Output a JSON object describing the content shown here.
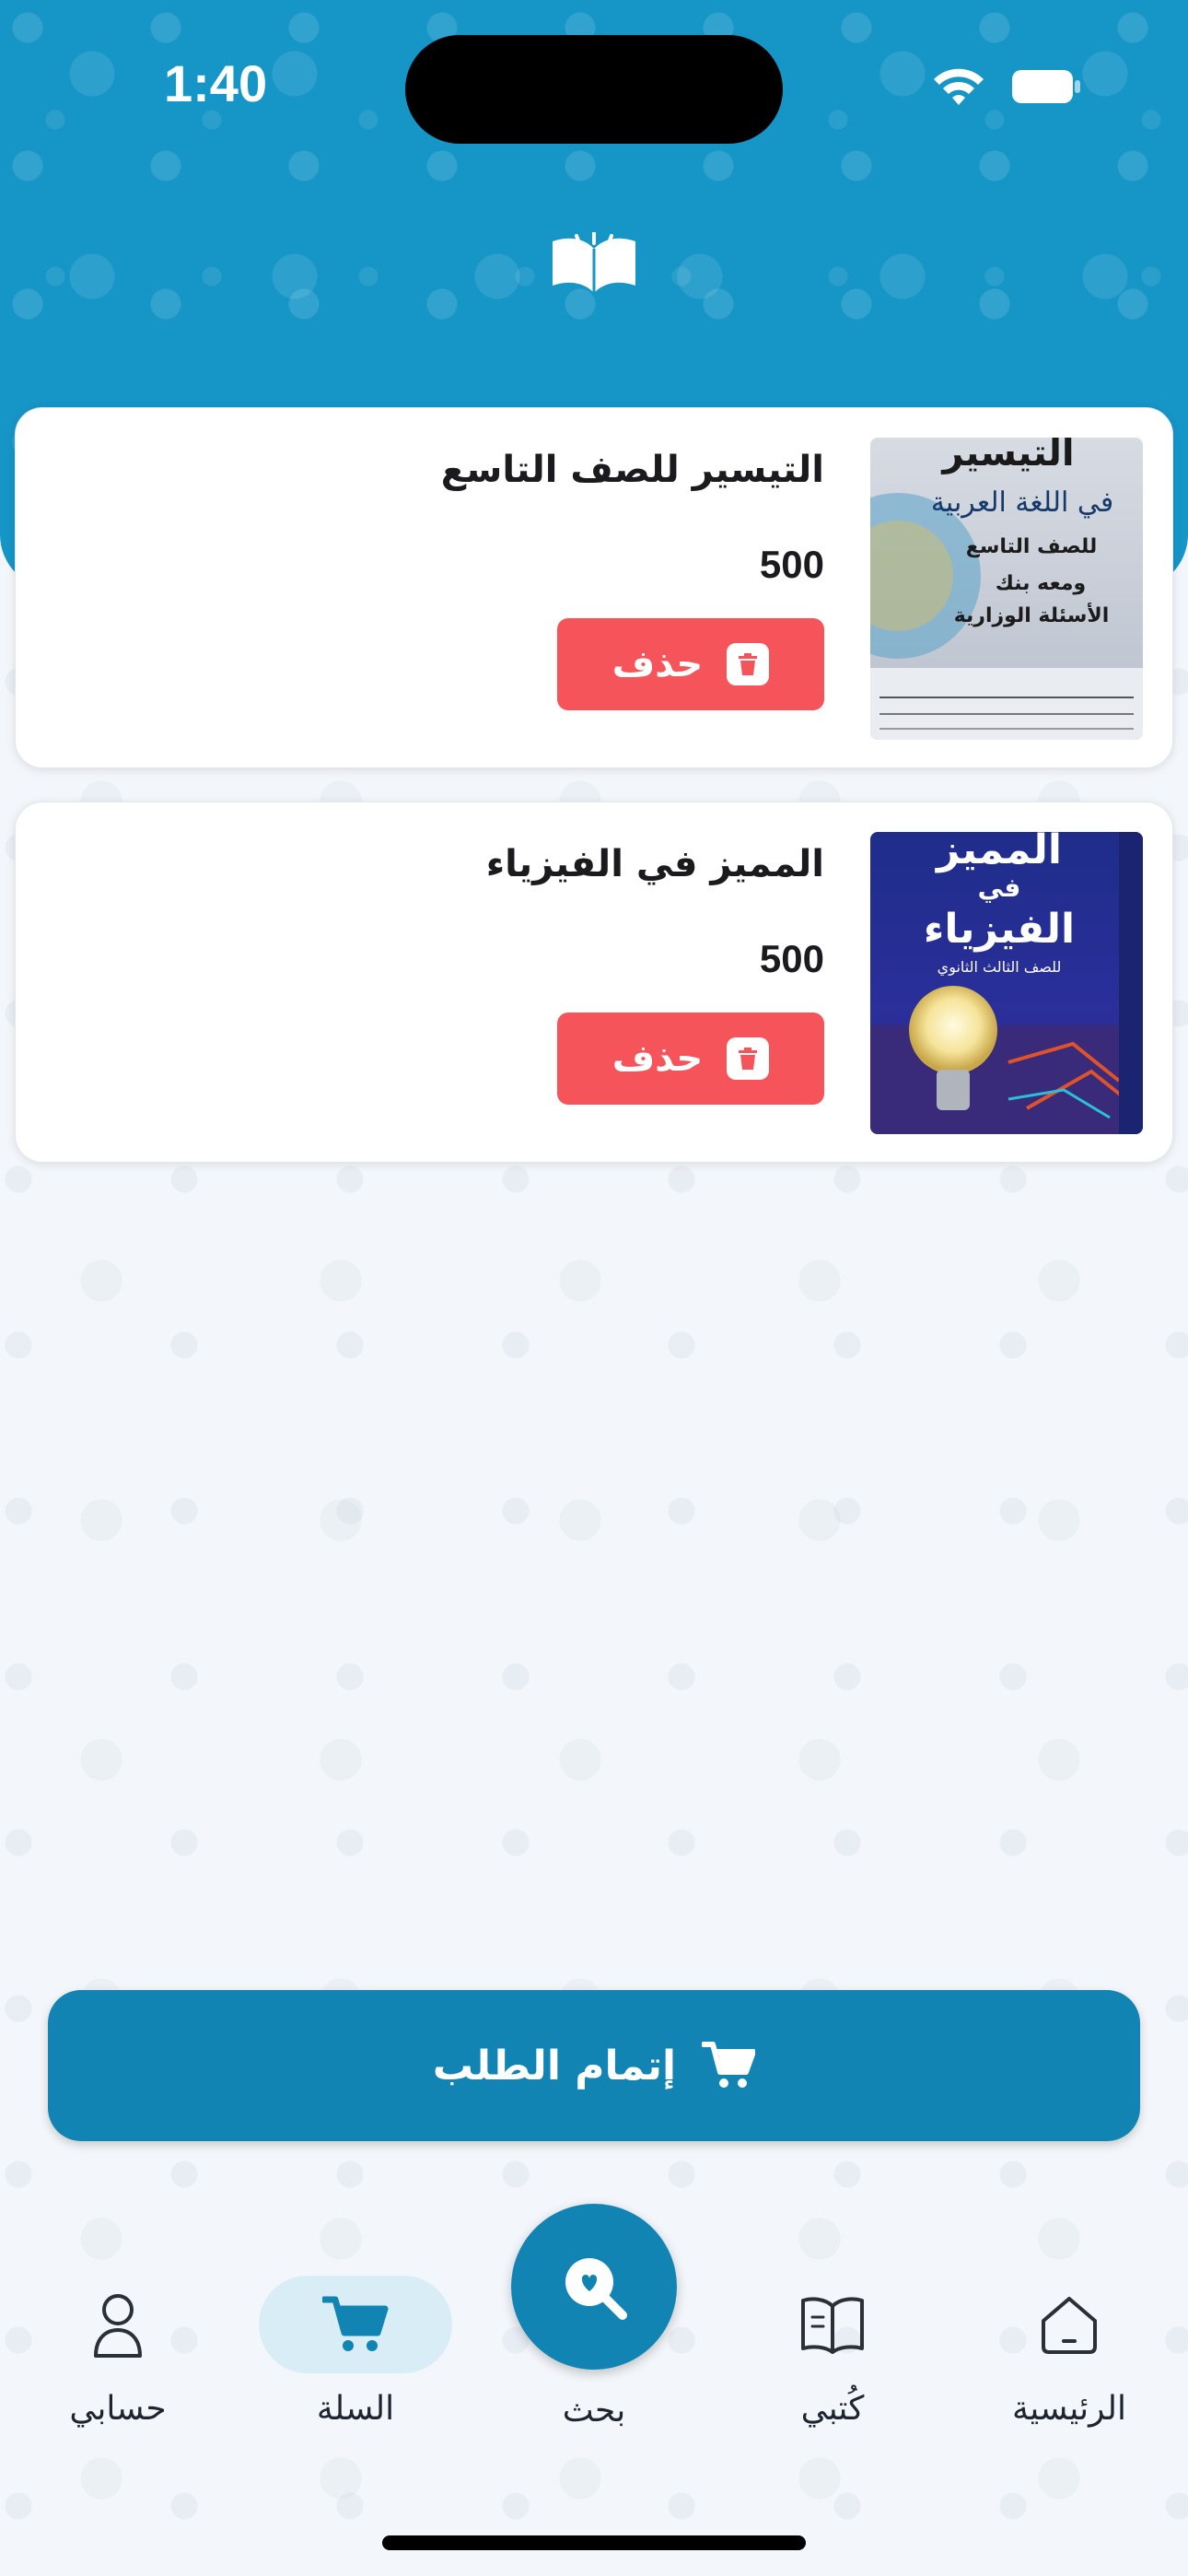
{
  "status_bar": {
    "time": "1:40"
  },
  "cart": {
    "items": [
      {
        "title": "التيسير للصف التاسع",
        "price": "500",
        "delete_label": "حذف",
        "cover": {
          "line1": "التيسير",
          "line2": "في اللغة العربية",
          "line3": "للصف التاسع",
          "line4": "ومعه بنك",
          "line5": "الأسئلة الوزارية"
        }
      },
      {
        "title": "المميز في الفيزياء",
        "price": "500",
        "delete_label": "حذف",
        "cover": {
          "line1": "المميز",
          "line2": "في",
          "line3": "الفيزياء",
          "line4": "للصف الثالث الثانوي"
        }
      }
    ],
    "checkout_label": "إتمام الطلب"
  },
  "nav": {
    "account": "حسابي",
    "cart": "السلة",
    "search": "بحث",
    "my_books": "كُتبي",
    "home": "الرئيسية",
    "active": "cart"
  },
  "icons": {
    "logo": "open-book-logo-icon",
    "wifi": "wifi-icon",
    "battery": "battery-icon",
    "trash": "trash-icon",
    "cart": "cart-icon",
    "search": "search-icon",
    "account": "user-icon",
    "books": "book-icon",
    "home": "home-icon"
  },
  "colors": {
    "header": "#1695c7",
    "primary": "#1184b3",
    "delete": "#f5555a",
    "active_nav_bg": "#d9edf6"
  }
}
